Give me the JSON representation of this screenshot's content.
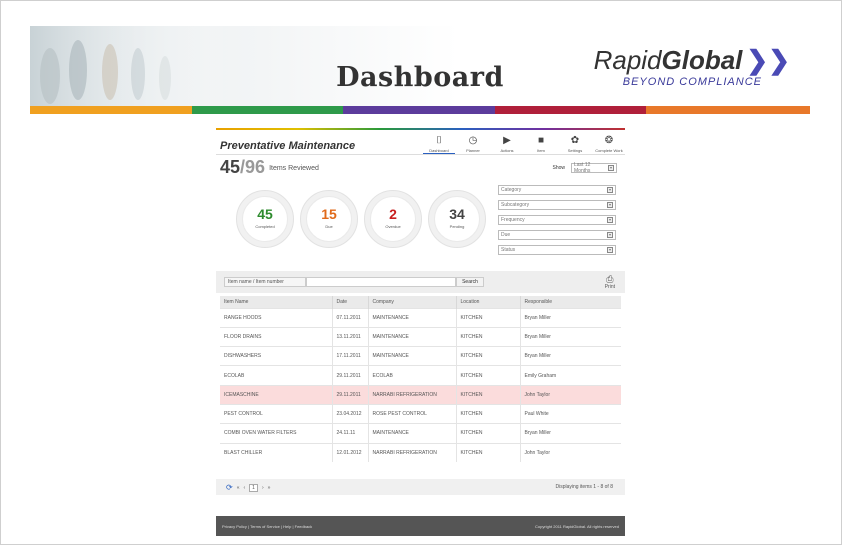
{
  "header": {
    "title": "Dashboard",
    "logo_main": "Rapid",
    "logo_bold": "Global",
    "logo_chevron": "❯❯",
    "logo_sub": "BEYOND COMPLIANCE"
  },
  "colors": {
    "bar": [
      "#f0a020",
      "#2e9a4a",
      "#5c3c9c",
      "#b01f3a",
      "#e8782a"
    ]
  },
  "panel": {
    "title": "Preventative Maintenance",
    "nav": [
      {
        "icon": "dashboard-icon",
        "glyph": "⌷",
        "label": "Dashboard"
      },
      {
        "icon": "planner-icon",
        "glyph": "◷",
        "label": "Planner"
      },
      {
        "icon": "actions-icon",
        "glyph": "▶",
        "label": "Actions"
      },
      {
        "icon": "item-icon",
        "glyph": "■",
        "label": "Item"
      },
      {
        "icon": "settings-icon",
        "glyph": "✿",
        "label": "Settings"
      },
      {
        "icon": "complete-work-icon",
        "glyph": "❂",
        "label": "Complete Work"
      }
    ],
    "reviewed": {
      "count": "45",
      "total": "/96",
      "label": "Items Reviewed"
    },
    "show": {
      "label": "Show",
      "value": "Last 12 Months"
    },
    "stats": [
      {
        "value": "45",
        "label": "Completed",
        "color": "#2e8b2e"
      },
      {
        "value": "15",
        "label": "Due",
        "color": "#e06a1a"
      },
      {
        "value": "2",
        "label": "Overdue",
        "color": "#c82020"
      },
      {
        "value": "34",
        "label": "Pending",
        "color": "#444444"
      }
    ],
    "filters": [
      "Category",
      "Subcategory",
      "Frequency",
      "Due",
      "Status"
    ],
    "search": {
      "label": "Item name / Item number",
      "value": "",
      "button": "Search",
      "print": "Print"
    },
    "table": {
      "headers": [
        "Item Name",
        "Date",
        "Company",
        "Location",
        "Responsible"
      ],
      "rows": [
        [
          "RANGE HOODS",
          "07.11.2011",
          "MAINTENANCE",
          "KITCHEN",
          "Bryan Miller"
        ],
        [
          "FLOOR DRAINS",
          "13.11.2011",
          "MAINTENANCE",
          "KITCHEN",
          "Bryan Miller"
        ],
        [
          "DISHWASHERS",
          "17.11.2011",
          "MAINTENANCE",
          "KITCHEN",
          "Bryan Miller"
        ],
        [
          "ECOLAB",
          "29.11.2011",
          "ECOLAB",
          "KITCHEN",
          "Emily Graham"
        ],
        [
          "ICEMASCHINE",
          "29.11.2011",
          "NARRABI REFRIGERATION",
          "KITCHEN",
          "John Taylor"
        ],
        [
          "PEST CONTROL",
          "23.04.2012",
          "ROSE PEST CONTROL",
          "KITCHEN",
          "Paul White"
        ],
        [
          "COMBI OVEN WATER FILTERS",
          "24.11.11",
          "MAINTENANCE",
          "KITCHEN",
          "Bryan Miller"
        ],
        [
          "BLAST CHILLER",
          "12.01.2012",
          "NARRABI REFRIGERATION",
          "KITCHEN",
          "John Taylor"
        ]
      ],
      "highlight_row": 4
    },
    "pager": {
      "first": "«",
      "prev": "‹",
      "page": "1",
      "next": "›",
      "last": "»",
      "display": "Displaying items 1 - 8 of 8"
    },
    "footer": {
      "links": "Privacy Policy  |  Terms of Service  |  Help  |  Feedback",
      "copyright": "Copyright 2011 RapidGlobal. All rights reserved"
    }
  }
}
